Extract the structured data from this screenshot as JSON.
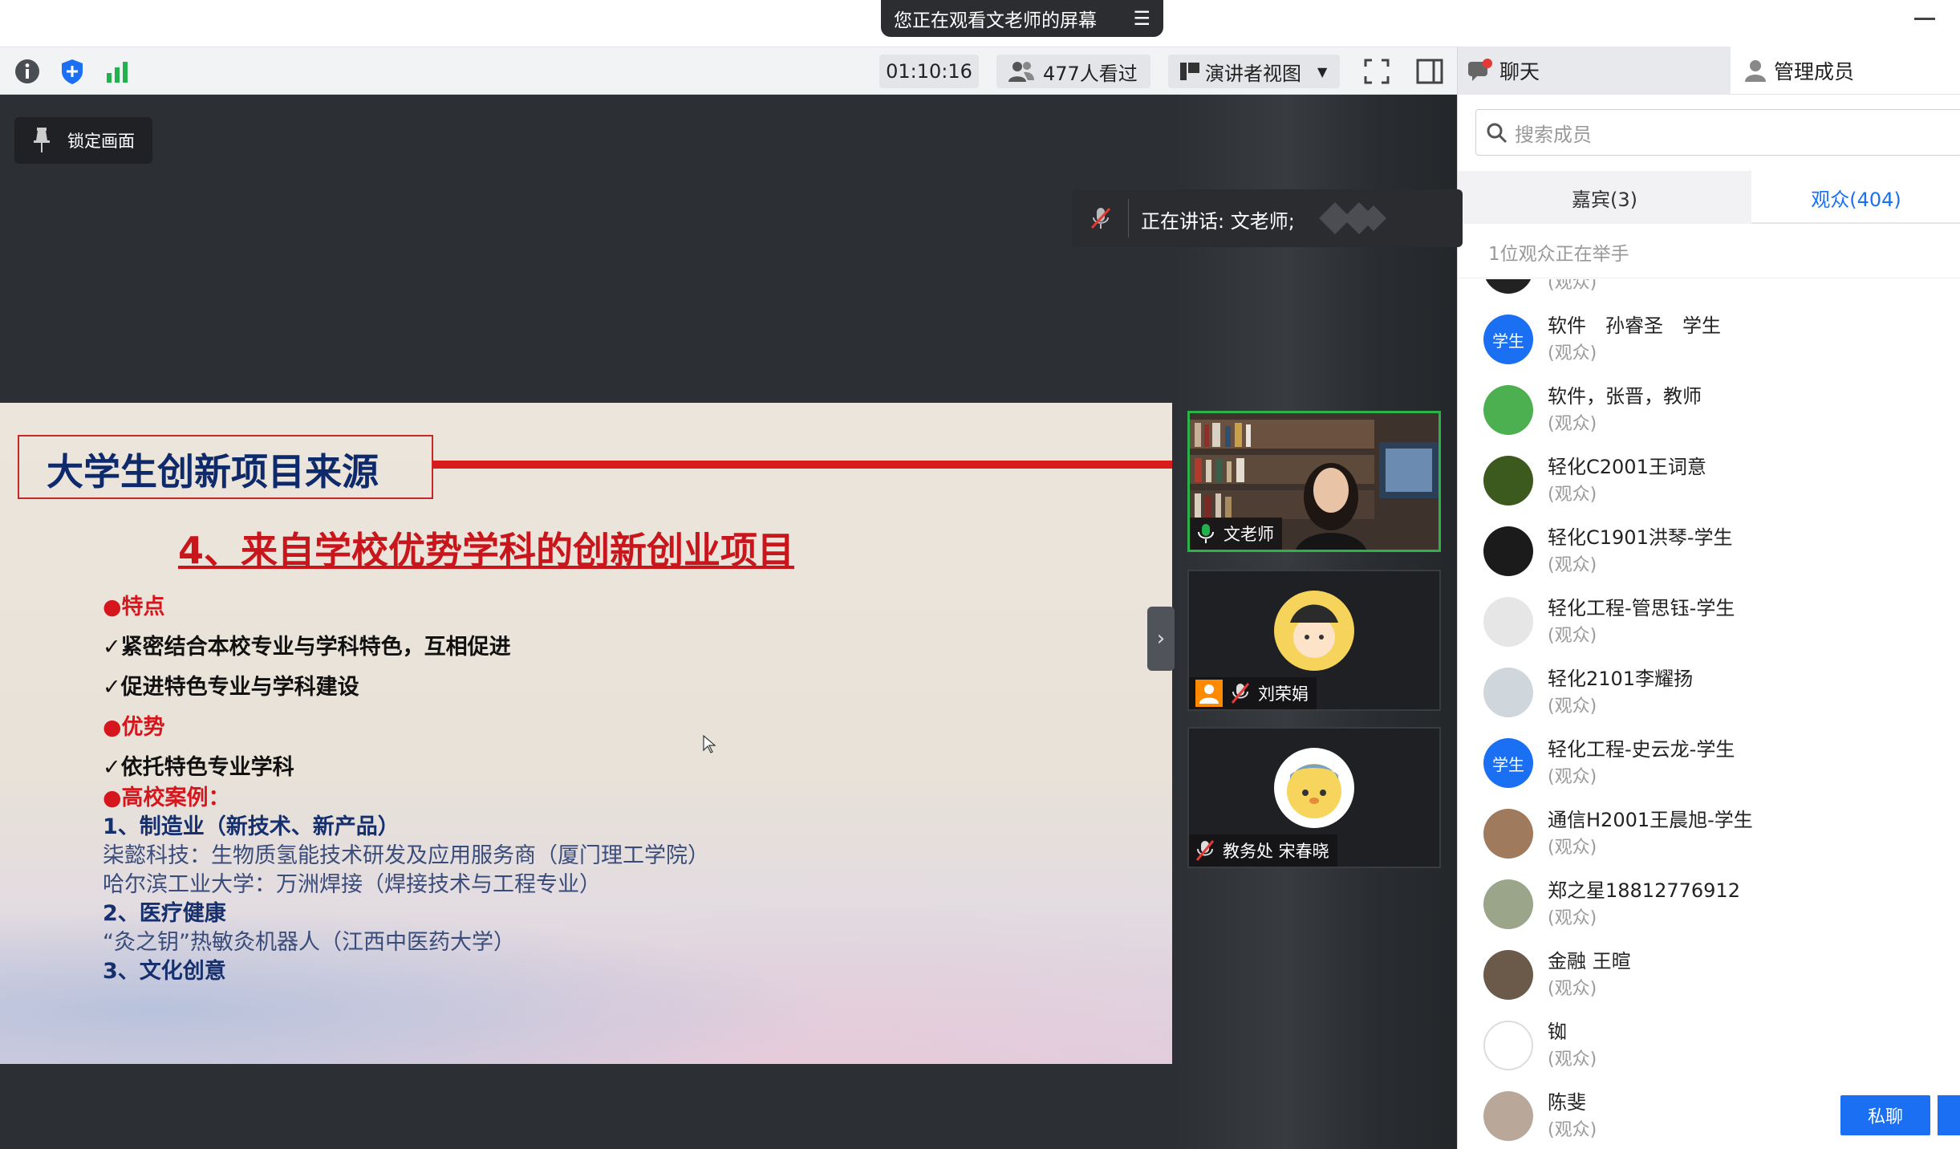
{
  "window": {
    "share_banner": "您正在观看文老师的屏幕"
  },
  "toolbar": {
    "timer": "01:10:16",
    "viewers": "477人看过",
    "view_mode": "演讲者视图"
  },
  "stage": {
    "lock_label": "锁定画面",
    "speaking_label": "正在讲话: 文老师;"
  },
  "slide": {
    "title": "大学生创新项目来源",
    "subtitle": "4、来自学校优势学科的创新创业项目",
    "lines": [
      "●特点",
      "✓紧密结合本校专业与学科特色，互相促进",
      "✓促进特色专业与学科建设",
      "●优势",
      "✓依托特色专业学科",
      "●高校案例：",
      "1、制造业（新技术、新产品）",
      "柒懿科技：生物质氢能技术研发及应用服务商（厦门理工学院）",
      "哈尔滨工业大学：万洲焊接（焊接技术与工程专业）",
      "2、医疗健康",
      "“灸之钥”热敏灸机器人（江西中医药大学）",
      "3、文化创意"
    ]
  },
  "tiles": [
    {
      "name": "文老师"
    },
    {
      "name": "刘荣娟"
    },
    {
      "name": "教务处 宋春晓"
    }
  ],
  "panel": {
    "tab_chat": "聊天",
    "tab_members": "管理成员",
    "search_placeholder": "搜索成员",
    "guest_tab": "嘉宾(3)",
    "audience_tab": "观众(404)",
    "hand_raise": "1位观众正在举手",
    "partial_role": "(观众)",
    "members": [
      {
        "name": "软件　孙睿圣　学生",
        "role": "(观众)",
        "avatar_text": "学生",
        "color": "#1a6ff2"
      },
      {
        "name": "软件，张晋，教师",
        "role": "(观众)",
        "avatar_text": "",
        "color": "#4caf50"
      },
      {
        "name": "轻化C2001王词意",
        "role": "(观众)",
        "avatar_text": "",
        "color": "#3d5a1e"
      },
      {
        "name": "轻化C1901洪琴-学生",
        "role": "(观众)",
        "avatar_text": "",
        "color": "#1b1b1b"
      },
      {
        "name": "轻化工程-管思钰-学生",
        "role": "(观众)",
        "avatar_text": "",
        "color": "#e6e6e6"
      },
      {
        "name": "轻化2101李耀扬",
        "role": "(观众)",
        "avatar_text": "",
        "color": "#cfd6dc"
      },
      {
        "name": "轻化工程-史云龙-学生",
        "role": "(观众)",
        "avatar_text": "学生",
        "color": "#1a6ff2"
      },
      {
        "name": "通信H2001王晨旭-学生",
        "role": "(观众)",
        "avatar_text": "",
        "color": "#a07a5c"
      },
      {
        "name": "郑之星18812776912",
        "role": "(观众)",
        "avatar_text": "",
        "color": "#9aa58a"
      },
      {
        "name": "金融 王暄",
        "role": "(观众)",
        "avatar_text": "",
        "color": "#6b5a4a"
      },
      {
        "name": "铷",
        "role": "(观众)",
        "avatar_text": "",
        "color": "#ffffff"
      },
      {
        "name": "陈斐",
        "role": "(观众)",
        "avatar_text": "",
        "color": "#b9a89a"
      }
    ],
    "private_chat": "私聊"
  }
}
